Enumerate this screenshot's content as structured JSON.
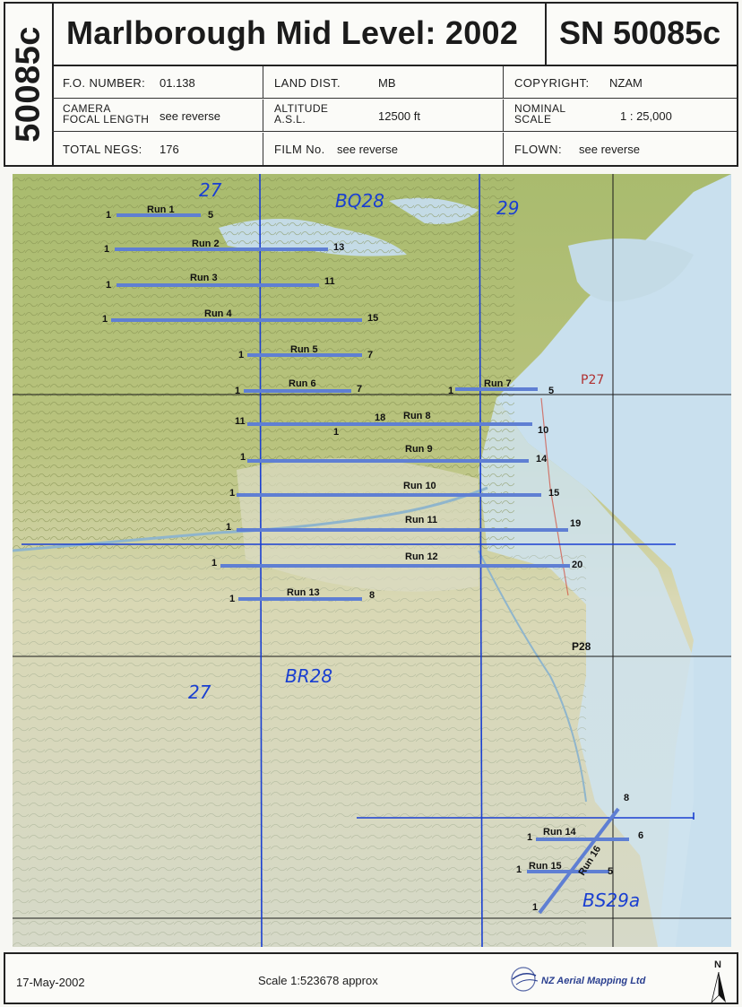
{
  "sheet": {
    "serial_vertical": "50085c",
    "title": "Marlborough Mid Level: 2002",
    "serial": "SN 50085c"
  },
  "info": {
    "fo_number_label": "F.O. NUMBER:",
    "fo_number": "01.138",
    "land_dist_label": "LAND DIST.",
    "land_dist": "MB",
    "copyright_label": "COPYRIGHT:",
    "copyright": "NZAM",
    "camera_label_1": "CAMERA",
    "camera_label_2": "FOCAL LENGTH",
    "camera": "see reverse",
    "altitude_label_1": "ALTITUDE",
    "altitude_label_2": "A.S.L.",
    "altitude": "12500 ft",
    "scale_label_1": "NOMINAL",
    "scale_label_2": "SCALE",
    "scale": "1 : 25,000",
    "total_negs_label": "TOTAL NEGS:",
    "total_negs": "176",
    "film_label": "FILM No.",
    "film": "see reverse",
    "flown_label": "FLOWN:",
    "flown": "see reverse"
  },
  "runs": [
    {
      "name": "Run 1",
      "start": "1",
      "end": "5"
    },
    {
      "name": "Run 2",
      "start": "1",
      "end": "13"
    },
    {
      "name": "Run 3",
      "start": "1",
      "end": "11"
    },
    {
      "name": "Run 4",
      "start": "1",
      "end": "15"
    },
    {
      "name": "Run 5",
      "start": "1",
      "end": "7"
    },
    {
      "name": "Run 6",
      "start": "1",
      "end": "7"
    },
    {
      "name": "Run 7",
      "start": "1",
      "end": "5"
    },
    {
      "name": "Run 8",
      "start": "11",
      "end": "10",
      "mid_a": "18",
      "mid_b": "1"
    },
    {
      "name": "Run 9",
      "start": "1",
      "end": "14"
    },
    {
      "name": "Run 10",
      "start": "1",
      "end": "15"
    },
    {
      "name": "Run 11",
      "start": "1",
      "end": "19"
    },
    {
      "name": "Run 12",
      "start": "1",
      "end": "20"
    },
    {
      "name": "Run 13",
      "start": "1",
      "end": "8"
    },
    {
      "name": "Run 14",
      "start": "1",
      "end": "6"
    },
    {
      "name": "Run 15",
      "start": "1",
      "end": "5"
    },
    {
      "name": "Run 16",
      "start": "1",
      "end": "8"
    }
  ],
  "sheet_labels": {
    "top_left": "27",
    "top_mid": "BQ28",
    "top_right": "29",
    "right_mid": "P27",
    "p28": "P28",
    "bottom_left": "27",
    "bottom_mid": "BR28",
    "bottom_right": "BS29a"
  },
  "footer": {
    "date": "17-May-2002",
    "scale": "Scale  1:523678 approx",
    "company": "NZ Aerial Mapping Ltd",
    "north": "N"
  },
  "colors": {
    "run_line": "#5f7fd3",
    "pen_blue": "#1a3fd1",
    "sea": "#c9e0ee",
    "land": "#b9c98a"
  }
}
